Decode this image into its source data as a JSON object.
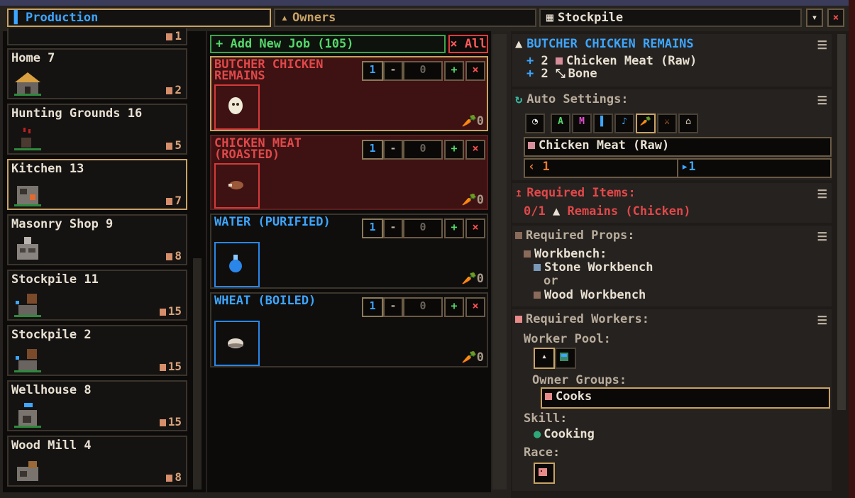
{
  "tabs": [
    {
      "label": "Production",
      "icon": "hammer-icon",
      "active": true
    },
    {
      "label": "Owners",
      "icon": "person-icon",
      "active": false
    },
    {
      "label": "Stockpile",
      "icon": "crate-icon",
      "active": false
    }
  ],
  "window": {
    "collapse_glyph": "▾",
    "close_glyph": "×"
  },
  "workshops": [
    {
      "name": "",
      "count": "1"
    },
    {
      "name": "Home 7",
      "count": "2"
    },
    {
      "name": "Hunting Grounds 16",
      "count": "5"
    },
    {
      "name": "Kitchen 13",
      "count": "7",
      "selected": true
    },
    {
      "name": "Masonry Shop 9",
      "count": "8"
    },
    {
      "name": "Stockpile 11",
      "count": "15"
    },
    {
      "name": "Stockpile 2",
      "count": "15"
    },
    {
      "name": "Wellhouse 8",
      "count": "15"
    },
    {
      "name": "Wood Mill 4",
      "count": "8"
    }
  ],
  "jobs_panel": {
    "add_job_label": "+ Add New Job (105)",
    "all_label": "× All",
    "jobs": [
      {
        "title": "BUTCHER CHICKEN REMAINS",
        "qty": "1",
        "value": "0",
        "tools": "0",
        "style": "red",
        "selected": true
      },
      {
        "title": "CHICKEN MEAT (ROASTED)",
        "qty": "1",
        "value": "0",
        "tools": "0",
        "style": "red"
      },
      {
        "title": "WATER (PURIFIED)",
        "qty": "1",
        "value": "0",
        "tools": "0",
        "style": "blue"
      },
      {
        "title": "WHEAT (BOILED)",
        "qty": "1",
        "value": "0",
        "tools": "0",
        "style": "blue"
      }
    ],
    "ctl": {
      "minus": "-",
      "plus": "+",
      "x": "×"
    },
    "tool_glyph": "🥕"
  },
  "details": {
    "title": "BUTCHER CHICKEN REMAINS",
    "outputs": [
      {
        "prefix": "+",
        "qty": "2",
        "name": "Chicken Meat (Raw)"
      },
      {
        "prefix": "+",
        "qty": "2",
        "name": "Bone"
      }
    ],
    "auto_settings": {
      "label": "Auto Settings:",
      "buttons": [
        "◔",
        "A",
        "M",
        "▌",
        "♪",
        "🥕",
        "⚔",
        "⌂"
      ],
      "item": "Chicken Meat (Raw)",
      "min": "1",
      "max": "1"
    },
    "required_items": {
      "label": "Required Items:",
      "progress": "0/1",
      "item": "Remains (Chicken)"
    },
    "required_props": {
      "label": "Required Props:",
      "prop": "Workbench:",
      "option1": "Stone Workbench",
      "or": "or",
      "option2": "Wood Workbench"
    },
    "required_workers": {
      "label": "Required Workers:",
      "worker_pool_label": "Worker Pool:",
      "owner_groups_label": "Owner Groups:",
      "owner_group": "Cooks",
      "skill_label": "Skill:",
      "skill": "Cooking",
      "race_label": "Race:"
    },
    "menu_glyph": "☰"
  },
  "colors": {
    "accent_blue": "#3da6ff",
    "accent_gold": "#c8a264",
    "required_red": "#e0484a",
    "add_green": "#55d86a"
  }
}
